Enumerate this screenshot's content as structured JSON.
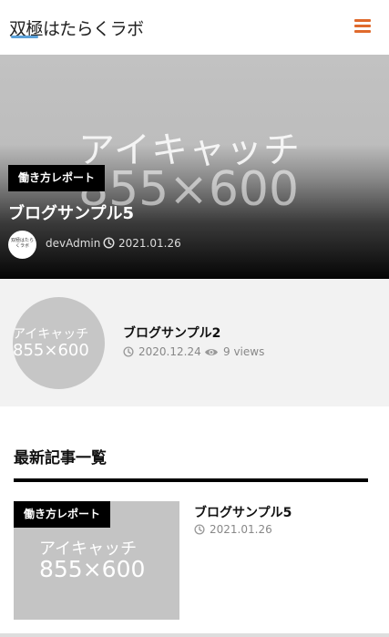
{
  "header": {
    "logo_text": "双極はたらくラボ",
    "menu_icon": "hamburger-menu-icon"
  },
  "hero": {
    "placeholder_line1": "アイキャッチ",
    "placeholder_line2": "855×600",
    "category": "働き方レポート",
    "title": "ブログサンプル5",
    "avatar_text": "双極はたらくラボ",
    "author": "devAdmin",
    "date": "2021.01.26"
  },
  "popular": {
    "placeholder_line1": "アイキャッチ",
    "placeholder_line2": "855×600",
    "title": "ブログサンプル2",
    "date": "2020.12.24",
    "views": "9 views"
  },
  "latest": {
    "section_title": "最新記事一覧",
    "posts": [
      {
        "placeholder_line1": "アイキャッチ",
        "placeholder_line2": "855×600",
        "category": "働き方レポート",
        "title": "ブログサンプル5",
        "date": "2021.01.26"
      }
    ]
  },
  "colors": {
    "accent": "#e06a2c",
    "logo_underline": "#5aa0d8",
    "placeholder_gray": "#c4c4c4",
    "card_bg": "#f2f2f2"
  }
}
